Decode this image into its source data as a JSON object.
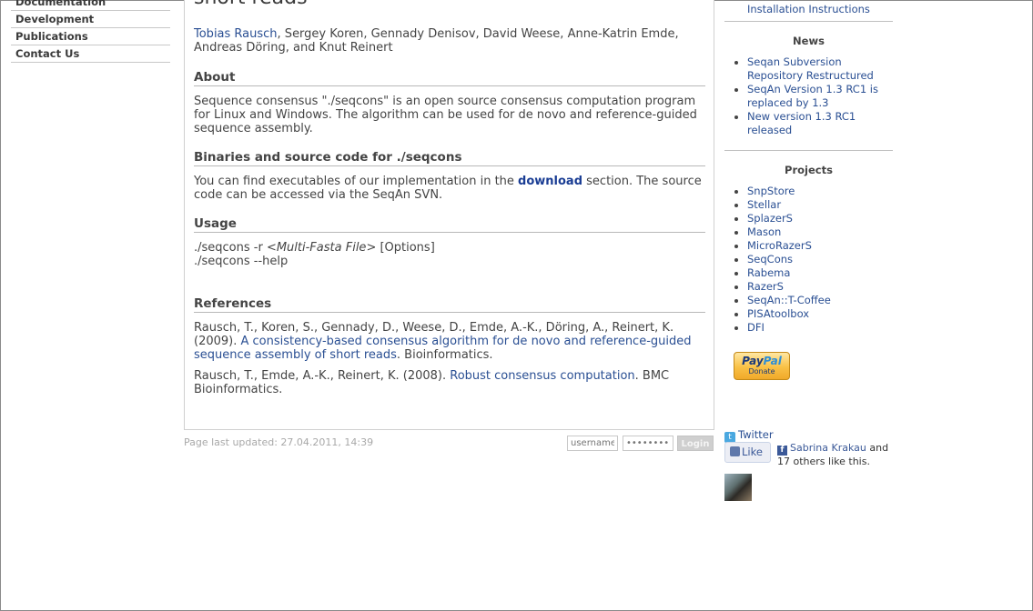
{
  "nav": {
    "items": [
      {
        "label": "Documentation"
      },
      {
        "label": "Development"
      },
      {
        "label": "Publications"
      },
      {
        "label": "Contact Us"
      }
    ]
  },
  "main": {
    "title": "short reads",
    "authors": {
      "link_author": "Tobias Rausch",
      "rest": ", Sergey Koren, Gennady Denisov, David Weese, Anne-Katrin Emde, Andreas Döring, and Knut Reinert"
    },
    "about": {
      "heading": "About",
      "text": "Sequence consensus \"./seqcons\" is an open source consensus computation program for Linux and Windows. The algorithm can be used for de novo and reference-guided sequence assembly."
    },
    "binaries": {
      "heading": "Binaries and source code for ./seqcons",
      "text_before": "You can find executables of our implementation in the ",
      "link": "download",
      "text_after": " section. The source code can be accessed via the SeqAn SVN."
    },
    "usage": {
      "heading": "Usage",
      "line1_cmd": "./seqcons -r <",
      "line1_arg": "Multi-Fasta File",
      "line1_rest": "> [Options]",
      "line2": "./seqcons --help"
    },
    "references": {
      "heading": "References",
      "ref1_authors": "Rausch, T., Koren, S., Gennady, D., Weese, D., Emde, A.-K., Döring, A., Reinert, K. (2009). ",
      "ref1_title": "A consistency-based consensus algorithm for de novo and reference-guided sequence assembly of short reads",
      "ref1_journal": ". Bioinformatics.",
      "ref2_authors": "Rausch, T., Emde, A.-K., Reinert, K. (2008). ",
      "ref2_title": "Robust consensus computation",
      "ref2_journal": ". BMC Bioinformatics."
    }
  },
  "footer": {
    "updated": "Page last updated: 27.04.2011, 14:39",
    "username_placeholder": "username",
    "password_placeholder": "••••••••",
    "login_label": "Login"
  },
  "sidebar": {
    "install_link": "Installation Instructions",
    "news": {
      "heading": "News",
      "items": [
        {
          "label": "Seqan Subversion Repository Restructured"
        },
        {
          "label": "SeqAn Version 1.3 RC1 is replaced by 1.3"
        },
        {
          "label": "New version 1.3 RC1 released"
        }
      ]
    },
    "projects": {
      "heading": "Projects",
      "items": [
        {
          "label": "SnpStore"
        },
        {
          "label": "Stellar"
        },
        {
          "label": "SplazerS"
        },
        {
          "label": "Mason"
        },
        {
          "label": "MicroRazerS"
        },
        {
          "label": "SeqCons"
        },
        {
          "label": "Rabema"
        },
        {
          "label": "RazerS"
        },
        {
          "label": "SeqAn::T-Coffee"
        },
        {
          "label": "PISAtoolbox"
        },
        {
          "label": "DFI"
        }
      ]
    },
    "paypal": {
      "logo_a": "Pay",
      "logo_b": "Pal",
      "donate": "Donate"
    },
    "twitter": {
      "icon": "t",
      "label": "Twitter"
    },
    "facebook": {
      "like_label": "Like",
      "icon": "f",
      "name": "Sabrina Krakau",
      "rest": " and 17 others like this."
    }
  }
}
